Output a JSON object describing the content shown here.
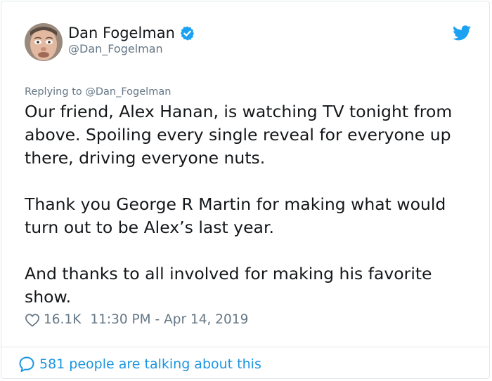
{
  "tweet": {
    "author": {
      "display_name": "Dan Fogelman",
      "handle": "@Dan_Fogelman",
      "verified": true
    },
    "reply_context": "Replying to @Dan_Fogelman",
    "paragraphs": [
      [
        "Our friend, Alex Hanan, is watching TV tonight from",
        "above. Spoiling every single reveal for everyone up",
        "there, driving everyone nuts."
      ],
      [
        "Thank you George R Martin for making what would",
        "turn out to be Alex’s last year."
      ],
      [
        "And thanks to all involved for making his favorite",
        "show."
      ]
    ],
    "likes": "16.1K",
    "timestamp": "11:30 PM - Apr 14, 2019",
    "conversation_label": "581 people are talking about this"
  },
  "icons": {
    "verified": "verified-badge-icon",
    "brand": "twitter-bird-icon",
    "like": "heart-outline-icon",
    "reply": "speech-bubble-icon"
  },
  "colors": {
    "brand_blue": "#1da1f2",
    "link_blue": "#1b95e0",
    "text": "#14171a",
    "muted": "#657786",
    "border": "#e1e8ed"
  }
}
